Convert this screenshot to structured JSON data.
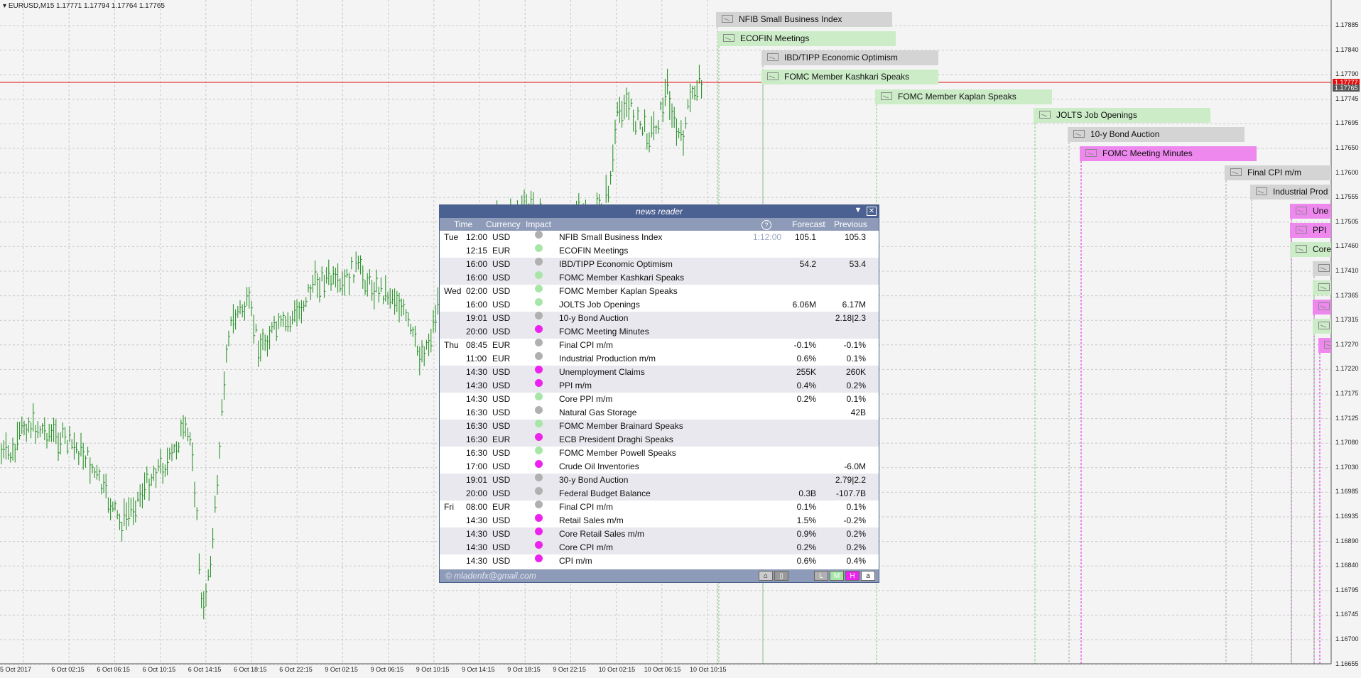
{
  "chart": {
    "title": "EURUSD,M15  1.17771 1.17794 1.17764 1.17765",
    "bid_price": "1.17777",
    "ask_price": "1.17765",
    "colors": {
      "candle": "#1a8a1a",
      "bid_line": "#e01010",
      "low": "#b0b0b0",
      "medium": "#a8e6a8",
      "high": "#ee66ee"
    },
    "price_labels": [
      "1.17885",
      "1.17840",
      "1.17790",
      "1.17745",
      "1.17695",
      "1.17650",
      "1.17600",
      "1.17555",
      "1.17505",
      "1.17460",
      "1.17410",
      "1.17365",
      "1.17315",
      "1.17270",
      "1.17220",
      "1.17175",
      "1.17125",
      "1.17080",
      "1.17030",
      "1.16985",
      "1.16935",
      "1.16890",
      "1.16840",
      "1.16795",
      "1.16745",
      "1.16700",
      "1.16655"
    ],
    "time_labels": [
      "5 Oct 2017",
      "6 Oct 02:15",
      "6 Oct 06:15",
      "6 Oct 10:15",
      "6 Oct 14:15",
      "6 Oct 18:15",
      "6 Oct 22:15",
      "9 Oct 02:15",
      "9 Oct 06:15",
      "9 Oct 10:15",
      "9 Oct 14:15",
      "9 Oct 18:15",
      "9 Oct 22:15",
      "10 Oct 02:15",
      "10 Oct 06:15",
      "10 Oct 10:15"
    ]
  },
  "banners": [
    {
      "label": "NFIB Small Business Index",
      "impact": "low"
    },
    {
      "label": "ECOFIN Meetings",
      "impact": "medium"
    },
    {
      "label": "IBD/TIPP Economic Optimism",
      "impact": "low"
    },
    {
      "label": "FOMC Member Kashkari Speaks",
      "impact": "medium"
    },
    {
      "label": "FOMC Member Kaplan Speaks",
      "impact": "medium"
    },
    {
      "label": "JOLTS Job Openings",
      "impact": "medium"
    },
    {
      "label": "10-y Bond Auction",
      "impact": "low"
    },
    {
      "label": "FOMC Meeting Minutes",
      "impact": "high"
    },
    {
      "label": "Final CPI m/m",
      "impact": "low"
    },
    {
      "label": "Industrial Prod",
      "impact": "low"
    },
    {
      "label": "Une",
      "impact": "high"
    },
    {
      "label": "PPI",
      "impact": "high"
    },
    {
      "label": "Core",
      "impact": "medium"
    },
    {
      "label": "",
      "impact": "low"
    },
    {
      "label": "",
      "impact": "medium"
    },
    {
      "label": "",
      "impact": "high"
    },
    {
      "label": "",
      "impact": "medium"
    },
    {
      "label": "",
      "impact": "high"
    }
  ],
  "news_reader": {
    "title": "news reader",
    "columns": {
      "time": "Time",
      "currency": "Currency",
      "impact": "Impact",
      "forecast": "Forecast",
      "previous": "Previous",
      "help": "?"
    },
    "countdown": "1:12:00",
    "rows": [
      {
        "day": "Tue",
        "time": "12:00",
        "cur": "USD",
        "impact": "low",
        "event": "NFIB Small Business Index",
        "forecast": "105.1",
        "previous": "105.3"
      },
      {
        "day": "",
        "time": "12:15",
        "cur": "EUR",
        "impact": "medium",
        "event": "ECOFIN Meetings",
        "forecast": "",
        "previous": ""
      },
      {
        "day": "",
        "time": "16:00",
        "cur": "USD",
        "impact": "low",
        "event": "IBD/TIPP Economic Optimism",
        "forecast": "54.2",
        "previous": "53.4"
      },
      {
        "day": "",
        "time": "16:00",
        "cur": "USD",
        "impact": "medium",
        "event": "FOMC Member Kashkari Speaks",
        "forecast": "",
        "previous": ""
      },
      {
        "day": "Wed",
        "time": "02:00",
        "cur": "USD",
        "impact": "medium",
        "event": "FOMC Member Kaplan Speaks",
        "forecast": "",
        "previous": ""
      },
      {
        "day": "",
        "time": "16:00",
        "cur": "USD",
        "impact": "medium",
        "event": "JOLTS Job Openings",
        "forecast": "6.06M",
        "previous": "6.17M"
      },
      {
        "day": "",
        "time": "19:01",
        "cur": "USD",
        "impact": "low",
        "event": "10-y Bond Auction",
        "forecast": "",
        "previous": "2.18|2.3"
      },
      {
        "day": "",
        "time": "20:00",
        "cur": "USD",
        "impact": "high",
        "event": "FOMC Meeting Minutes",
        "forecast": "",
        "previous": ""
      },
      {
        "day": "Thu",
        "time": "08:45",
        "cur": "EUR",
        "impact": "low",
        "event": "Final CPI m/m",
        "forecast": "-0.1%",
        "previous": "-0.1%"
      },
      {
        "day": "",
        "time": "11:00",
        "cur": "EUR",
        "impact": "low",
        "event": "Industrial Production m/m",
        "forecast": "0.6%",
        "previous": "0.1%"
      },
      {
        "day": "",
        "time": "14:30",
        "cur": "USD",
        "impact": "high",
        "event": "Unemployment Claims",
        "forecast": "255K",
        "previous": "260K"
      },
      {
        "day": "",
        "time": "14:30",
        "cur": "USD",
        "impact": "high",
        "event": "PPI m/m",
        "forecast": "0.4%",
        "previous": "0.2%"
      },
      {
        "day": "",
        "time": "14:30",
        "cur": "USD",
        "impact": "medium",
        "event": "Core PPI m/m",
        "forecast": "0.2%",
        "previous": "0.1%"
      },
      {
        "day": "",
        "time": "16:30",
        "cur": "USD",
        "impact": "low",
        "event": "Natural Gas Storage",
        "forecast": "",
        "previous": "42B"
      },
      {
        "day": "",
        "time": "16:30",
        "cur": "USD",
        "impact": "medium",
        "event": "FOMC Member Brainard Speaks",
        "forecast": "",
        "previous": ""
      },
      {
        "day": "",
        "time": "16:30",
        "cur": "EUR",
        "impact": "high",
        "event": "ECB President Draghi Speaks",
        "forecast": "",
        "previous": ""
      },
      {
        "day": "",
        "time": "16:30",
        "cur": "USD",
        "impact": "medium",
        "event": "FOMC Member Powell Speaks",
        "forecast": "",
        "previous": ""
      },
      {
        "day": "",
        "time": "17:00",
        "cur": "USD",
        "impact": "high",
        "event": "Crude Oil Inventories",
        "forecast": "",
        "previous": "-6.0M"
      },
      {
        "day": "",
        "time": "19:01",
        "cur": "USD",
        "impact": "low",
        "event": "30-y Bond Auction",
        "forecast": "",
        "previous": "2.79|2.2"
      },
      {
        "day": "",
        "time": "20:00",
        "cur": "USD",
        "impact": "low",
        "event": "Federal Budget Balance",
        "forecast": "0.3B",
        "previous": "-107.7B"
      },
      {
        "day": "Fri",
        "time": "08:00",
        "cur": "EUR",
        "impact": "low",
        "event": "Final CPI m/m",
        "forecast": "0.1%",
        "previous": "0.1%"
      },
      {
        "day": "",
        "time": "14:30",
        "cur": "USD",
        "impact": "high",
        "event": "Retail Sales m/m",
        "forecast": "1.5%",
        "previous": "-0.2%"
      },
      {
        "day": "",
        "time": "14:30",
        "cur": "USD",
        "impact": "high",
        "event": "Core Retail Sales m/m",
        "forecast": "0.9%",
        "previous": "0.2%"
      },
      {
        "day": "",
        "time": "14:30",
        "cur": "USD",
        "impact": "high",
        "event": "Core CPI m/m",
        "forecast": "0.2%",
        "previous": "0.2%"
      },
      {
        "day": "",
        "time": "14:30",
        "cur": "USD",
        "impact": "high",
        "event": "CPI m/m",
        "forecast": "0.6%",
        "previous": "0.4%"
      }
    ],
    "footer": {
      "email": "© mladenfx@gmail.com",
      "btn_low": "L",
      "btn_medium": "M",
      "btn_high": "H",
      "btn_all": "a"
    }
  }
}
